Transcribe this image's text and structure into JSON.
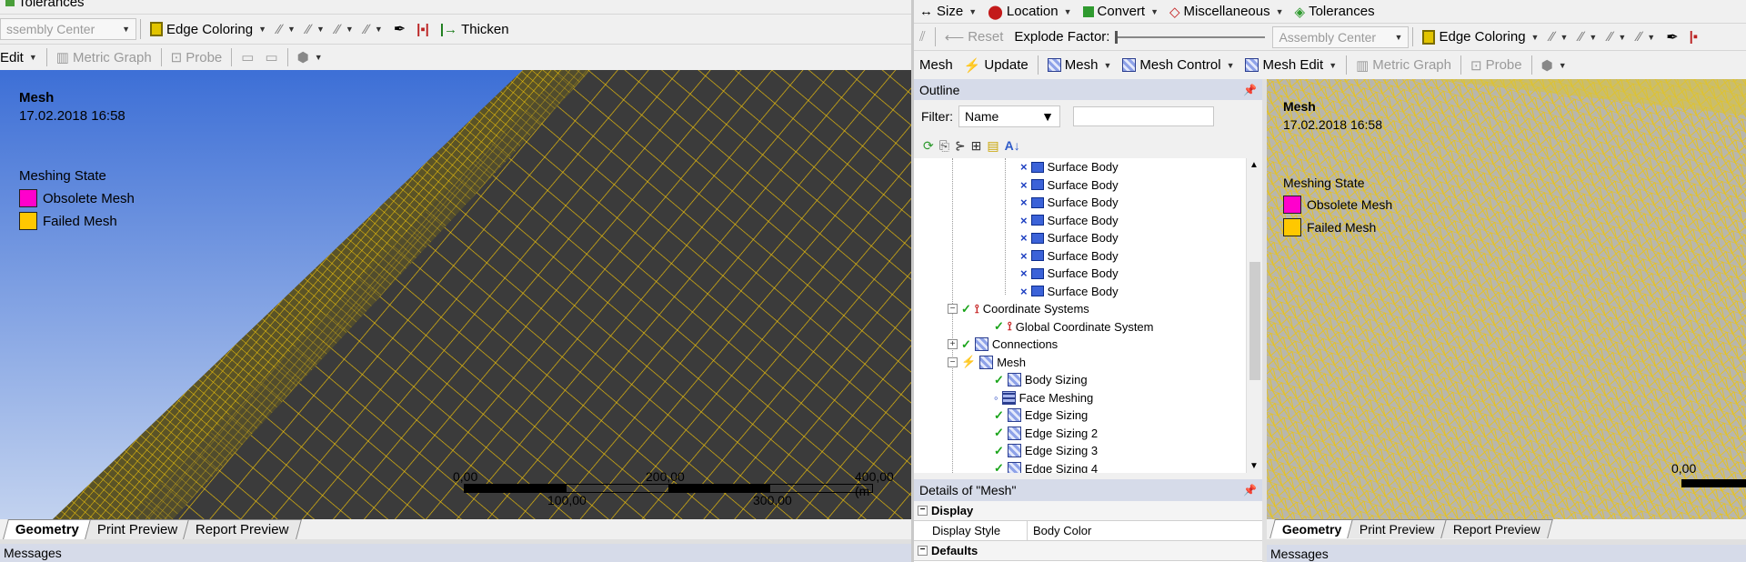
{
  "left": {
    "top_partial": {
      "label": "Tolerances"
    },
    "toolbar1": {
      "assembly_combo": "ssembly Center",
      "edge_coloring": "Edge Coloring",
      "thicken": "Thicken"
    },
    "toolbar2": {
      "edit": "Edit",
      "metric_graph": "Metric Graph",
      "probe": "Probe"
    },
    "viewport": {
      "title": "Mesh",
      "date": "17.02.2018 16:58",
      "state_label": "Meshing State",
      "legend": [
        {
          "label": "Obsolete Mesh",
          "color": "#ff00cc"
        },
        {
          "label": "Failed Mesh",
          "color": "#ffc800"
        }
      ],
      "scale": {
        "top_labels": [
          "0,00",
          "200,00",
          "400,00 (m"
        ],
        "bottom_labels": [
          "100,00",
          "300,00"
        ]
      }
    },
    "tabs": [
      "Geometry",
      "Print Preview",
      "Report Preview"
    ],
    "messages": "Messages"
  },
  "right": {
    "toolbar1": {
      "size": "Size",
      "location": "Location",
      "convert": "Convert",
      "misc": "Miscellaneous",
      "tolerances": "Tolerances"
    },
    "toolbar2": {
      "reset": "Reset",
      "explode_factor": "Explode Factor:",
      "assembly_combo": "Assembly Center",
      "edge_coloring": "Edge Coloring"
    },
    "toolbar3": {
      "mesh": "Mesh",
      "update": "Update",
      "mesh_menu": "Mesh",
      "mesh_control": "Mesh Control",
      "mesh_edit": "Mesh Edit",
      "metric_graph": "Metric Graph",
      "probe": "Probe"
    },
    "outline": {
      "title": "Outline",
      "filter_label": "Filter:",
      "filter_value": "Name",
      "tree": [
        {
          "label": "Surface Body",
          "kind": "body"
        },
        {
          "label": "Surface Body",
          "kind": "body"
        },
        {
          "label": "Surface Body",
          "kind": "body"
        },
        {
          "label": "Surface Body",
          "kind": "body"
        },
        {
          "label": "Surface Body",
          "kind": "body"
        },
        {
          "label": "Surface Body",
          "kind": "body"
        },
        {
          "label": "Surface Body",
          "kind": "body"
        },
        {
          "label": "Surface Body",
          "kind": "body"
        },
        {
          "label": "Coordinate Systems",
          "kind": "coord"
        },
        {
          "label": "Global Coordinate System",
          "kind": "coord"
        },
        {
          "label": "Connections",
          "kind": "conn"
        },
        {
          "label": "Mesh",
          "kind": "mesh"
        },
        {
          "label": "Body Sizing",
          "kind": "meshctl"
        },
        {
          "label": "Face Meshing",
          "kind": "face"
        },
        {
          "label": "Edge Sizing",
          "kind": "meshctl"
        },
        {
          "label": "Edge Sizing 2",
          "kind": "meshctl"
        },
        {
          "label": "Edge Sizing 3",
          "kind": "meshctl"
        },
        {
          "label": "Edge Sizing 4",
          "kind": "meshctl"
        }
      ]
    },
    "details": {
      "title": "Details of \"Mesh\"",
      "categories": [
        {
          "name": "Display",
          "rows": [
            {
              "key": "Display Style",
              "value": "Body Color"
            }
          ]
        },
        {
          "name": "Defaults",
          "rows": []
        }
      ]
    },
    "viewport": {
      "title": "Mesh",
      "date": "17.02.2018 16:58",
      "state_label": "Meshing State",
      "legend": [
        {
          "label": "Obsolete Mesh",
          "color": "#ff00cc"
        },
        {
          "label": "Failed Mesh",
          "color": "#ffc800"
        }
      ],
      "scale_label": "0,00"
    },
    "tabs": [
      "Geometry",
      "Print Preview",
      "Report Preview"
    ],
    "messages": "Messages"
  }
}
